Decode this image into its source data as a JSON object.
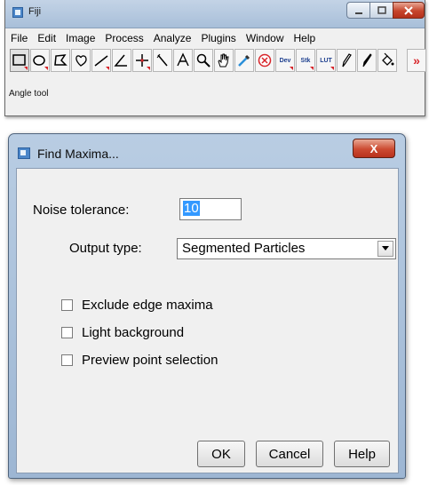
{
  "fiji": {
    "title": "Fiji",
    "menus": [
      "File",
      "Edit",
      "Image",
      "Process",
      "Analyze",
      "Plugins",
      "Window",
      "Help"
    ],
    "tools": {
      "dev_label": "Dev",
      "stk_label": "Stk",
      "lut_label": "LUT",
      "more_label": "»"
    },
    "status": "Angle tool"
  },
  "dialog": {
    "title": "Find Maxima...",
    "close_label": "X",
    "noise_label": "Noise tolerance:",
    "noise_value": "10",
    "output_label": "Output type:",
    "output_value": "Segmented Particles",
    "checkboxes": [
      {
        "label": "Exclude edge maxima",
        "checked": false
      },
      {
        "label": "Light background",
        "checked": false
      },
      {
        "label": "Preview point selection",
        "checked": false
      }
    ],
    "buttons": {
      "ok": "OK",
      "cancel": "Cancel",
      "help": "Help"
    }
  },
  "colors": {
    "dialog_frame": "#9db6d3",
    "close_button": "#cc4a31",
    "selection": "#3399ff",
    "tool_marker": "#d8252a"
  }
}
